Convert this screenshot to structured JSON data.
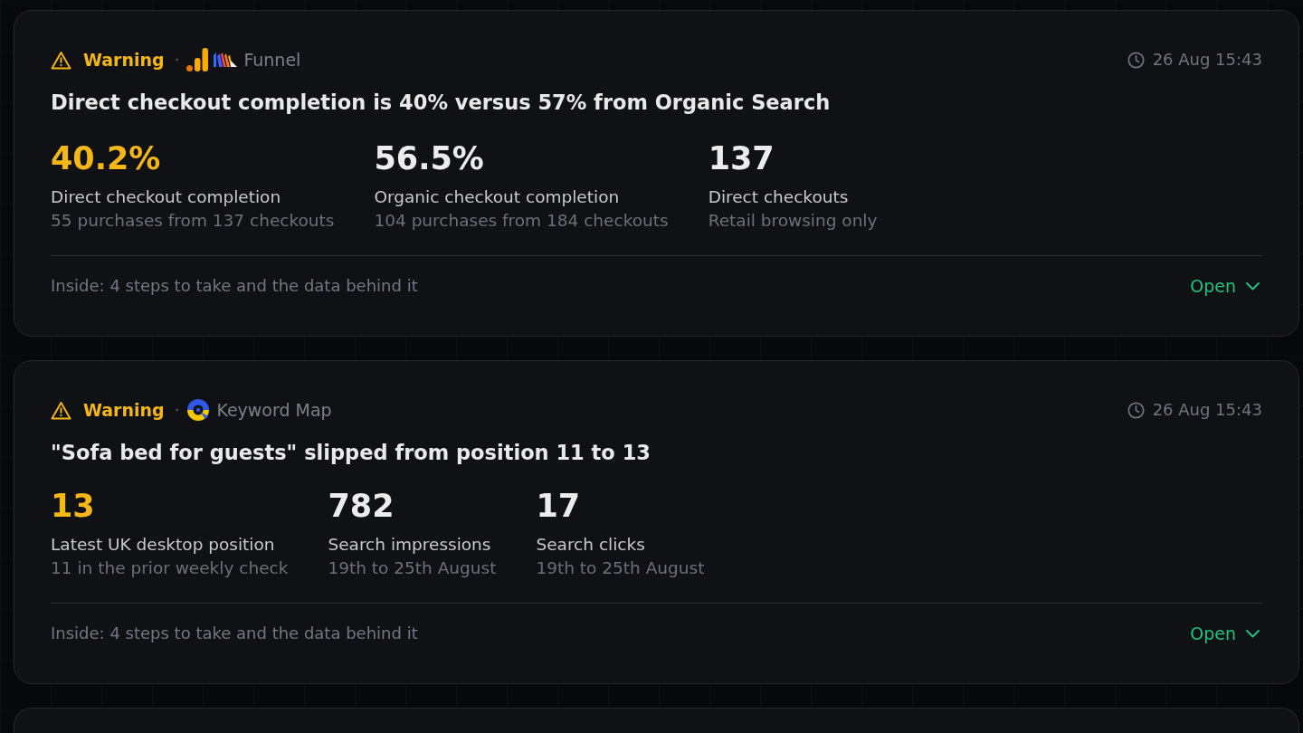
{
  "cards": [
    {
      "severity": {
        "kind": "warning",
        "label": "Warning"
      },
      "separator": "·",
      "source": {
        "kind": "funnel",
        "label": "Funnel"
      },
      "timestamp": "26 Aug 15:43",
      "title": "Direct checkout completion is 40% versus 57% from Organic Search",
      "metrics": [
        {
          "value": "40.2%",
          "highlighted": true,
          "label": "Direct checkout completion",
          "detail": "55 purchases from 137 checkouts"
        },
        {
          "value": "56.5%",
          "highlighted": false,
          "label": "Organic checkout completion",
          "detail": "104 purchases from 184 checkouts"
        },
        {
          "value": "137",
          "highlighted": false,
          "label": "Direct checkouts",
          "detail": "Retail browsing only"
        }
      ],
      "footer": "Inside: 4 steps to take and the data behind it",
      "action": {
        "label": "Open",
        "expanded": false
      }
    },
    {
      "severity": {
        "kind": "warning",
        "label": "Warning"
      },
      "separator": "·",
      "source": {
        "kind": "keyword_map",
        "label": "Keyword Map"
      },
      "timestamp": "26 Aug 15:43",
      "title": "\"Sofa bed for guests\" slipped from position 11 to 13",
      "metrics": [
        {
          "value": "13",
          "highlighted": true,
          "label": "Latest UK desktop position",
          "detail": "11 in the prior weekly check"
        },
        {
          "value": "782",
          "highlighted": false,
          "label": "Search impressions",
          "detail": "19th to 25th August"
        },
        {
          "value": "17",
          "highlighted": false,
          "label": "Search clicks",
          "detail": "19th to 25th August"
        }
      ],
      "footer": "Inside: 4 steps to take and the data behind it",
      "action": {
        "label": "Open",
        "expanded": false
      }
    }
  ]
}
